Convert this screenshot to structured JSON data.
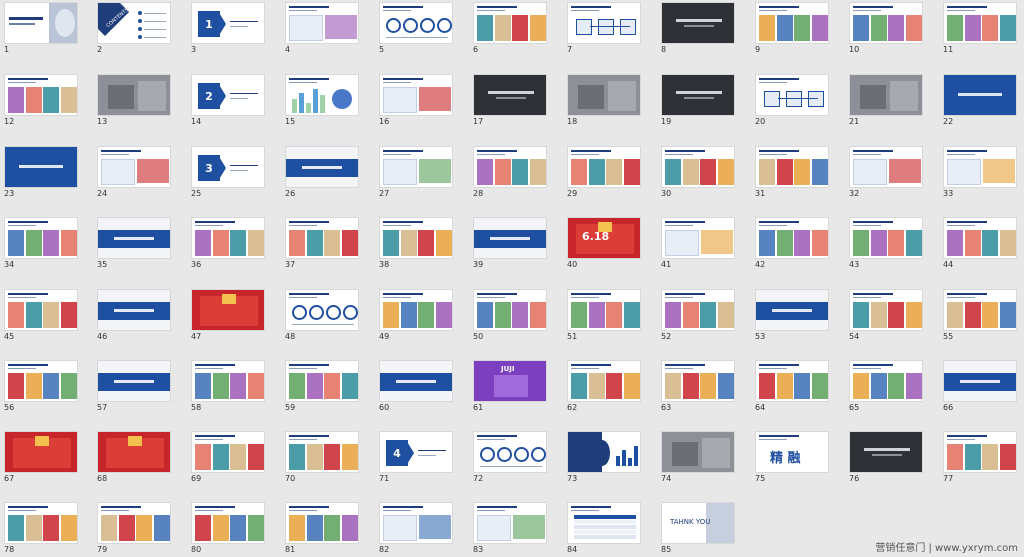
{
  "slides": [
    {
      "n": "1",
      "kind": "cover"
    },
    {
      "n": "2",
      "kind": "contents",
      "label": "CONTENTS"
    },
    {
      "n": "3",
      "kind": "section",
      "sec": "1"
    },
    {
      "n": "4",
      "kind": "content"
    },
    {
      "n": "5",
      "kind": "circles"
    },
    {
      "n": "6",
      "kind": "photos"
    },
    {
      "n": "7",
      "kind": "diagram"
    },
    {
      "n": "8",
      "kind": "dark"
    },
    {
      "n": "9",
      "kind": "photos"
    },
    {
      "n": "10",
      "kind": "photos"
    },
    {
      "n": "11",
      "kind": "photos"
    },
    {
      "n": "12",
      "kind": "photos"
    },
    {
      "n": "13",
      "kind": "photo-gray"
    },
    {
      "n": "14",
      "kind": "section",
      "sec": "2"
    },
    {
      "n": "15",
      "kind": "chart"
    },
    {
      "n": "16",
      "kind": "content"
    },
    {
      "n": "17",
      "kind": "dark"
    },
    {
      "n": "18",
      "kind": "photo-gray"
    },
    {
      "n": "19",
      "kind": "dark"
    },
    {
      "n": "20",
      "kind": "diagram"
    },
    {
      "n": "21",
      "kind": "photo-gray"
    },
    {
      "n": "22",
      "kind": "blue-full"
    },
    {
      "n": "23",
      "kind": "blue-full"
    },
    {
      "n": "24",
      "kind": "content"
    },
    {
      "n": "25",
      "kind": "section",
      "sec": "3"
    },
    {
      "n": "26",
      "kind": "blue-band"
    },
    {
      "n": "27",
      "kind": "content"
    },
    {
      "n": "28",
      "kind": "photos"
    },
    {
      "n": "29",
      "kind": "photos"
    },
    {
      "n": "30",
      "kind": "photos"
    },
    {
      "n": "31",
      "kind": "photos"
    },
    {
      "n": "32",
      "kind": "content"
    },
    {
      "n": "33",
      "kind": "content"
    },
    {
      "n": "34",
      "kind": "photos"
    },
    {
      "n": "35",
      "kind": "blue-band"
    },
    {
      "n": "36",
      "kind": "photos"
    },
    {
      "n": "37",
      "kind": "photos"
    },
    {
      "n": "38",
      "kind": "photos"
    },
    {
      "n": "39",
      "kind": "blue-band"
    },
    {
      "n": "40",
      "kind": "red-poster",
      "label": "6.18"
    },
    {
      "n": "41",
      "kind": "content"
    },
    {
      "n": "42",
      "kind": "photos"
    },
    {
      "n": "43",
      "kind": "photos"
    },
    {
      "n": "44",
      "kind": "photos"
    },
    {
      "n": "45",
      "kind": "photos"
    },
    {
      "n": "46",
      "kind": "blue-band"
    },
    {
      "n": "47",
      "kind": "red-poster",
      "label": ""
    },
    {
      "n": "48",
      "kind": "circles"
    },
    {
      "n": "49",
      "kind": "photos"
    },
    {
      "n": "50",
      "kind": "photos"
    },
    {
      "n": "51",
      "kind": "photos"
    },
    {
      "n": "52",
      "kind": "photos"
    },
    {
      "n": "53",
      "kind": "blue-band"
    },
    {
      "n": "54",
      "kind": "photos"
    },
    {
      "n": "55",
      "kind": "photos"
    },
    {
      "n": "56",
      "kind": "photos"
    },
    {
      "n": "57",
      "kind": "blue-band"
    },
    {
      "n": "58",
      "kind": "photos"
    },
    {
      "n": "59",
      "kind": "photos"
    },
    {
      "n": "60",
      "kind": "blue-band"
    },
    {
      "n": "61",
      "kind": "purple-poster",
      "label": "JUJI"
    },
    {
      "n": "62",
      "kind": "photos"
    },
    {
      "n": "63",
      "kind": "photos"
    },
    {
      "n": "64",
      "kind": "photos"
    },
    {
      "n": "65",
      "kind": "photos"
    },
    {
      "n": "66",
      "kind": "blue-band"
    },
    {
      "n": "67",
      "kind": "red-poster",
      "label": ""
    },
    {
      "n": "68",
      "kind": "red-poster",
      "label": ""
    },
    {
      "n": "69",
      "kind": "photos"
    },
    {
      "n": "70",
      "kind": "photos"
    },
    {
      "n": "71",
      "kind": "section",
      "sec": "4"
    },
    {
      "n": "72",
      "kind": "circles"
    },
    {
      "n": "73",
      "kind": "blue-split"
    },
    {
      "n": "74",
      "kind": "photo-gray"
    },
    {
      "n": "75",
      "kind": "words",
      "label": "精  融"
    },
    {
      "n": "76",
      "kind": "dark"
    },
    {
      "n": "77",
      "kind": "photos"
    },
    {
      "n": "78",
      "kind": "photos"
    },
    {
      "n": "79",
      "kind": "photos"
    },
    {
      "n": "80",
      "kind": "photos"
    },
    {
      "n": "81",
      "kind": "photos"
    },
    {
      "n": "82",
      "kind": "content"
    },
    {
      "n": "83",
      "kind": "content"
    },
    {
      "n": "84",
      "kind": "table"
    },
    {
      "n": "85",
      "kind": "thanks",
      "label": "TAHNK YOU"
    }
  ],
  "watermark": "营销任意门 | www.yxrym.com",
  "colors": {
    "blue": "#1f4fa0",
    "navy": "#1f3d7a",
    "red": "#c8242b",
    "dark": "#2e3136",
    "gray": "#8d9096",
    "purple": "#7b3fbf"
  }
}
